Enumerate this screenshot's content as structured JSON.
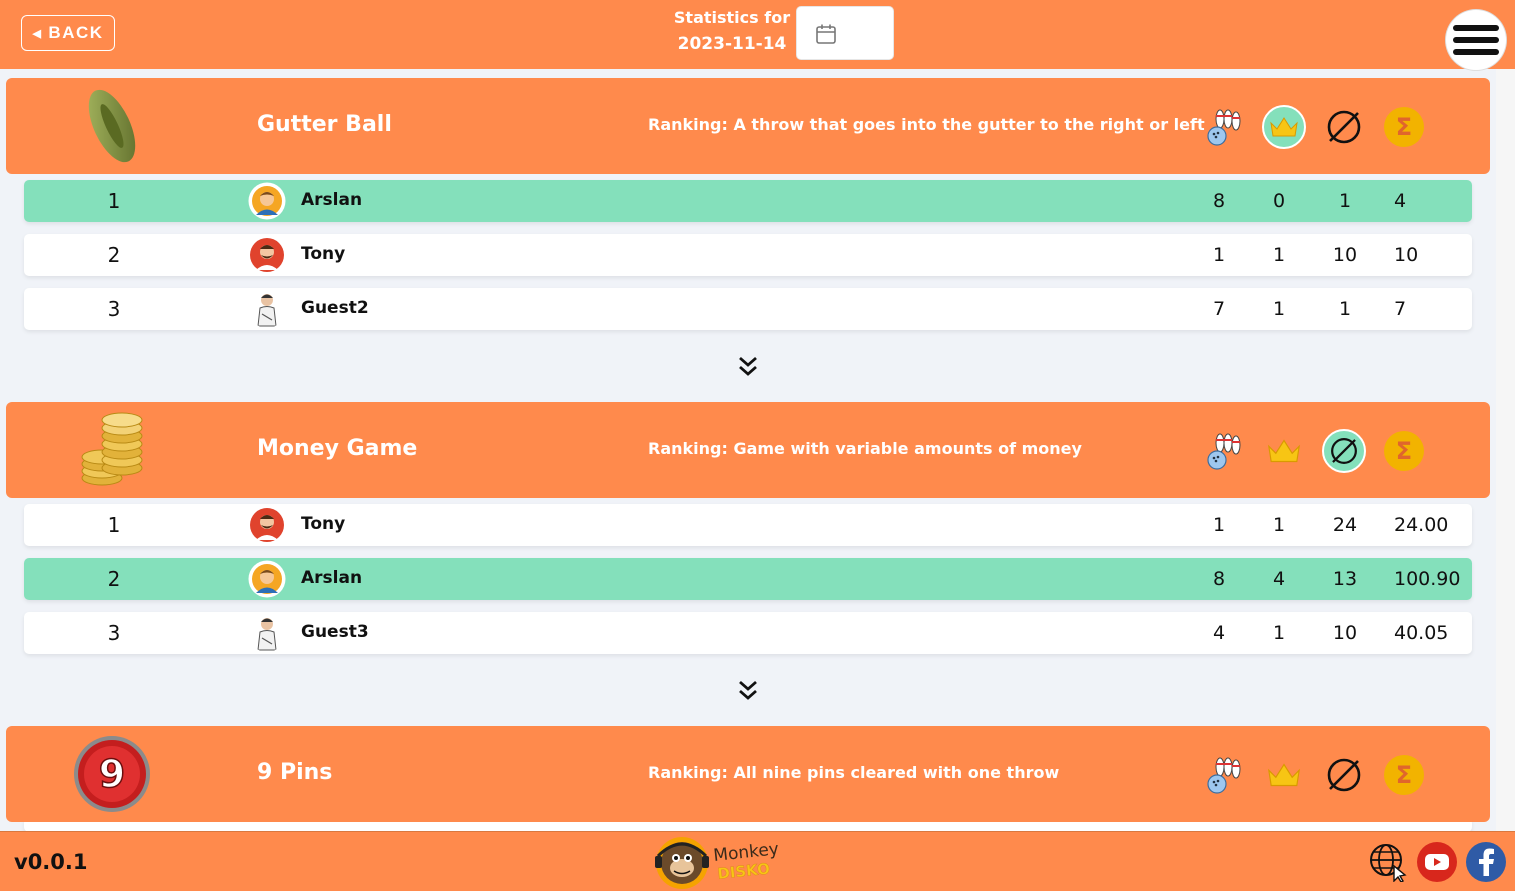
{
  "header": {
    "back_label": "BACK",
    "stats_label": "Statistics for",
    "date": "2023-11-14"
  },
  "sections": [
    {
      "title": "Gutter Ball",
      "description": "Ranking: A throw that goes into the gutter to the right or left",
      "icon": "gutter-ball-zero-icon",
      "active_column": "crown",
      "rows": [
        {
          "rank": "1",
          "name": "Arslan",
          "v1": "8",
          "v2": "0",
          "v3": "1",
          "v4": "4",
          "highlight": true
        },
        {
          "rank": "2",
          "name": "Tony",
          "v1": "1",
          "v2": "1",
          "v3": "10",
          "v4": "10"
        },
        {
          "rank": "3",
          "name": "Guest2",
          "v1": "7",
          "v2": "1",
          "v3": "1",
          "v4": "7"
        }
      ]
    },
    {
      "title": "Money Game",
      "description": "Ranking: Game with variable amounts of money",
      "icon": "coins-icon",
      "active_column": "avg",
      "rows": [
        {
          "rank": "1",
          "name": "Tony",
          "v1": "1",
          "v2": "1",
          "v3": "24",
          "v4": "24.00"
        },
        {
          "rank": "2",
          "name": "Arslan",
          "v1": "8",
          "v2": "4",
          "v3": "13",
          "v4": "100.90",
          "highlight": true
        },
        {
          "rank": "3",
          "name": "Guest3",
          "v1": "4",
          "v2": "1",
          "v3": "10",
          "v4": "40.05"
        }
      ]
    },
    {
      "title": "9 Pins",
      "description": "Ranking: All nine pins cleared with one throw",
      "icon": "nine-badge-icon",
      "active_column": "none"
    }
  ],
  "footer": {
    "version": "v0.0.1",
    "logo_text_top": "Monkey",
    "logo_text_bottom": "DISKO"
  },
  "colors": {
    "brand_orange": "#ff8a4c",
    "highlight_green": "#84e0bb",
    "gold": "#f2b300"
  }
}
